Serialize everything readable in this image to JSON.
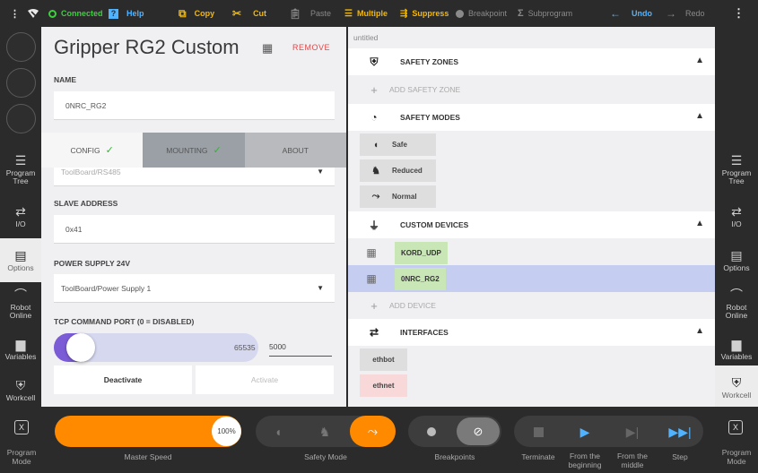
{
  "topbar": {
    "connected": "Connected",
    "help": "Help",
    "copy": "Copy",
    "cut": "Cut",
    "paste": "Paste",
    "multiple": "Multiple",
    "suppress": "Suppress",
    "breakpoint": "Breakpoint",
    "subprogram": "Subprogram",
    "undo": "Undo",
    "redo": "Redo"
  },
  "leftrail": {
    "items": [
      {
        "label": "Program Tree",
        "icon": "list-icon"
      },
      {
        "label": "I/O",
        "icon": "io-icon"
      },
      {
        "label": "Options",
        "icon": "clipboard-icon"
      },
      {
        "label": "Robot Online",
        "icon": "robot-arm-icon"
      },
      {
        "label": "Variables",
        "icon": "briefcase-icon"
      },
      {
        "label": "Workcell",
        "icon": "shield-icon"
      }
    ]
  },
  "rightrail": {
    "items": [
      {
        "label": "Program Tree",
        "icon": "list-icon"
      },
      {
        "label": "I/O",
        "icon": "io-icon"
      },
      {
        "label": "Options",
        "icon": "clipboard-icon"
      },
      {
        "label": "Robot Online",
        "icon": "robot-arm-icon"
      },
      {
        "label": "Variables",
        "icon": "briefcase-icon"
      },
      {
        "label": "Workcell",
        "icon": "shield-icon"
      }
    ]
  },
  "device": {
    "title": "Gripper RG2 Custom",
    "remove": "REMOVE",
    "name_label": "NAME",
    "name_value": "0NRC_RG2",
    "tabs": [
      "CONFIG",
      "MOUNTING",
      "ABOUT"
    ],
    "interface_value": "ToolBoard/RS485",
    "slave_label": "SLAVE ADDRESS",
    "slave_value": "0x41",
    "power_label": "POWER SUPPLY 24V",
    "power_value": "ToolBoard/Power Supply 1",
    "tcp_label": "TCP COMMAND PORT (0 = DISABLED)",
    "tcp_min": "0",
    "tcp_max": "65535",
    "tcp_value": "5000",
    "tcp_fraction": 0.0763,
    "deactivate": "Deactivate",
    "activate": "Activate"
  },
  "workcell": {
    "filename": "untitled",
    "safety_zones": "SAFETY ZONES",
    "add_zone": "ADD SAFETY ZONE",
    "safety_modes": "SAFETY MODES",
    "modes": [
      "Safe",
      "Reduced",
      "Normal"
    ],
    "custom_devices": "CUSTOM DEVICES",
    "devices": [
      "KORD_UDP",
      "0NRC_RG2"
    ],
    "add_device": "ADD DEVICE",
    "interfaces": "INTERFACES",
    "interface_items": [
      "ethbot",
      "ethnet"
    ]
  },
  "bottombar": {
    "program_mode": "Program Mode",
    "speed_value": "100%",
    "master_speed": "Master Speed",
    "safety_mode": "Safety Mode",
    "breakpoints": "Breakpoints",
    "terminate": "Terminate",
    "from_beginning": "From the beginning",
    "from_middle": "From the middle",
    "step": "Step"
  },
  "colors": {
    "accent_orange": "#ff8a00",
    "toolbar_yellow": "#f5b800",
    "connected_green": "#3ad13a",
    "undo_blue": "#4fb3ff",
    "remove_red": "#e04848",
    "device_green": "#c9e6b6",
    "selected_row": "#c5cdf0",
    "slider_purple": "#7b5bd6"
  }
}
